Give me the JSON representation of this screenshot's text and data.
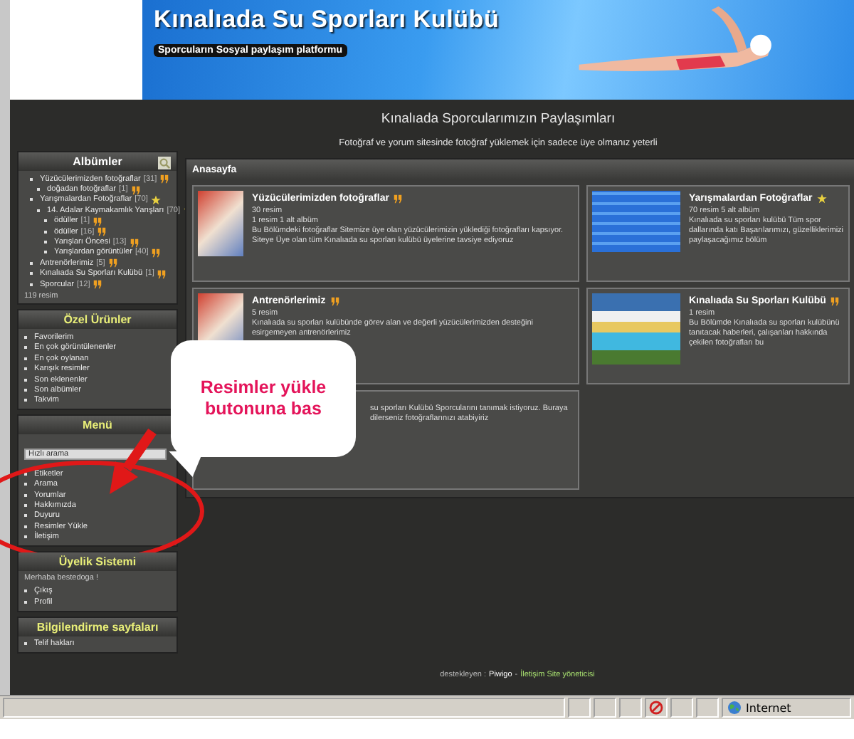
{
  "banner": {
    "title": "Kınalıada Su Sporları Kulübü",
    "subtitle": "Sporcuların Sosyal paylaşım platformu"
  },
  "page": {
    "title": "Kınalıada Sporcularımızın Paylaşımları",
    "subtitle": "Fotoğraf ve yorum sitesinde fotoğraf yüklemek için sadece üye olmanız yeterli"
  },
  "sidebar": [
    {
      "kind": "albums",
      "title": "Albümler",
      "accent": false,
      "items": [
        {
          "label": "Yüzücülerimizden fotoğraflar",
          "count": "[31]",
          "kind": "recent",
          "children": [
            {
              "label": "doğadan fotoğraflar",
              "count": "[1]",
              "kind": "recent"
            }
          ]
        },
        {
          "label": "Yarışmalardan Fotoğraflar",
          "count": "[70]",
          "kind": "updated",
          "children": [
            {
              "label": "14. Adalar Kaymakamlık Yarışları",
              "count": "[70]",
              "kind": "updated",
              "children": [
                {
                  "label": "ödüller",
                  "count": "[1]",
                  "kind": "recent"
                },
                {
                  "label": "ödüller",
                  "count": "[16]",
                  "kind": "recent"
                },
                {
                  "label": "Yarışları Öncesi",
                  "count": "[13]",
                  "kind": "recent"
                },
                {
                  "label": "Yarışlardan görüntüler",
                  "count": "[40]",
                  "kind": "recent"
                }
              ]
            }
          ]
        },
        {
          "label": "Antrenörlerimiz",
          "count": "[5]",
          "kind": "recent"
        },
        {
          "label": "Kınalıada Su Sporları Kulübü",
          "count": "[1]",
          "kind": "recent"
        },
        {
          "label": "Sporcular",
          "count": "[12]",
          "kind": "recent"
        }
      ],
      "total": "119 resim"
    },
    {
      "kind": "links",
      "title": "Özel Ürünler",
      "accent": true,
      "items": [
        "Favorilerim",
        "En çok görüntülenenler",
        "En çok oylanan",
        "Karışık resimler",
        "Son eklenenler",
        "Son albümler",
        "Takvim"
      ]
    },
    {
      "kind": "menu",
      "title": "Menü",
      "accent": true,
      "placeholder": "Hızlı arama",
      "items": [
        "Etiketler",
        "Arama",
        "Yorumlar",
        "Hakkımızda",
        "Duyuru",
        "Resimler Yükle",
        "İletişim"
      ]
    },
    {
      "kind": "member",
      "title": "Üyelik Sistemi",
      "accent": true,
      "greeting": "Merhaba bestedoga !",
      "items": [
        "Çıkış",
        "Profil"
      ]
    },
    {
      "kind": "links",
      "title": "Bilgilendirme sayfaları",
      "accent": true,
      "items": [
        "Telif hakları"
      ]
    }
  ],
  "main": {
    "title": "Anasayfa",
    "cards": [
      {
        "title": "Yüzücülerimizden fotoğraflar",
        "kind": "recent",
        "lines": [
          "30 resim",
          "1 resim 1 alt albüm"
        ],
        "description": "Bu Bölümdeki fotoğraflar Sitemize üye olan yüzücülerimizin yüklediği fotoğrafları kapsıyor. Siteye Üye olan tüm Kınalıada su sporları kulübü üyelerine tavsiye ediyoruz"
      },
      {
        "title": "Yarışmalardan Fotoğraflar",
        "kind": "updated",
        "lines": [
          "70 resim 5 alt albüm"
        ],
        "description": "Kınalıada su sporları kulübü Tüm spor dallarında katı Başarılarımızı, güzelliklerimizi paylaşacağımız bölüm"
      },
      {
        "title": "Antrenörlerimiz",
        "kind": "recent",
        "lines": [
          "5 resim"
        ],
        "description": "Kınalıada su sporları kulübünde görev alan ve değerli yüzücülerimizden desteğini esirgemeyen antrenörlerimiz"
      },
      {
        "title": "Kınalıada Su Sporları Kulübü",
        "kind": "recent",
        "lines": [
          "1 resim"
        ],
        "description": "Bu Bölümde Kınalıada su sporları kulübünü tanıtacak haberleri, çalışanları hakkında çekilen fotoğrafları bu"
      },
      {
        "description": "su sporları Kulübü Sporcularını tanımak istiyoruz. Buraya dilerseniz fotoğraflarınızı atabiyiriz"
      }
    ]
  },
  "footer": {
    "text": "destekleyen :",
    "engine": "Piwigo",
    "separator": "-",
    "contact": "İletişim Site yöneticisi"
  },
  "callout": {
    "text": "Resimler yükle butonuna bas"
  },
  "status_bar": {
    "zone": "Internet"
  }
}
